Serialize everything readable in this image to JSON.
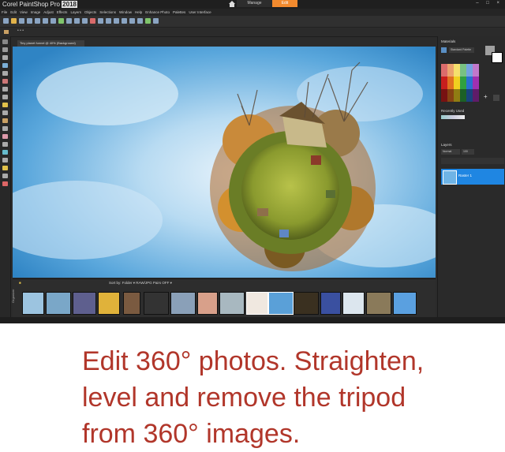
{
  "app": {
    "title": "Corel PaintShop Pro",
    "version": "2018",
    "workspace_tabs": [
      "Manage",
      "Edit"
    ]
  },
  "menu": [
    "File",
    "Edit",
    "View",
    "Image",
    "Adjust",
    "Effects",
    "Layers",
    "Objects",
    "Selections",
    "Window",
    "Help",
    "Enhance Photo",
    "Palettes",
    "User Interface"
  ],
  "document": {
    "tab_label": "Tiny planet funnel @ 40% (Background)"
  },
  "palettes": {
    "materials_title": "Materials",
    "materials_mode": "Standard Palette",
    "recently_used": "Recently Used",
    "layers_title": "Layers",
    "layer_blend": "Normal",
    "layer_opacity": "100",
    "layer_name": "Raster 1"
  },
  "organizer": {
    "label": "Organizer",
    "sort_label": "Sort by:",
    "sort_value": "Folder",
    "filter_value": "RAW/JPG Pairs OFF"
  },
  "caption": {
    "line1": "Edit 360° photos. Straighten,",
    "line2": "level and remove the tripod",
    "line3": "from 360° images."
  },
  "colors": {
    "accent_orange": "#f28a2e",
    "caption_red": "#b1362a",
    "layer_selected": "#1f86e2"
  }
}
